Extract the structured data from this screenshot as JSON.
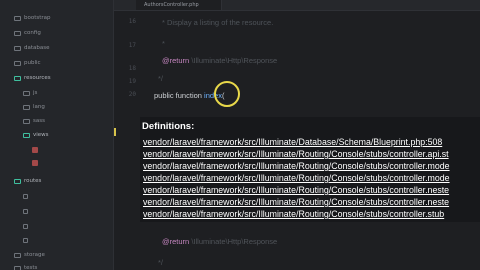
{
  "sidebar": {
    "items": [
      {
        "label": "bootstrap"
      },
      {
        "label": "config"
      },
      {
        "label": "database"
      },
      {
        "label": "public"
      },
      {
        "label": "resources"
      },
      {
        "label": "js"
      },
      {
        "label": "lang"
      },
      {
        "label": "sass"
      },
      {
        "label": "views"
      },
      {
        "label": "routes"
      },
      {
        "label": "storage"
      },
      {
        "label": "tests"
      }
    ]
  },
  "tabs": [
    {
      "label": "AuthorsController.php"
    }
  ],
  "editor": {
    "line_numbers": [
      "16",
      "17",
      "18",
      "19",
      "20"
    ],
    "lines": {
      "comment_desc": "* Display a listing of the resource.",
      "comment_star": "*",
      "return_tag": "@return",
      "return_type": "\\Illuminate\\Http\\Response",
      "comment_end": "*/",
      "method_keywords": "public function",
      "method_name": "index",
      "method_paren": "(",
      "return_tag_2": "@return",
      "return_type_2": "\\Illuminate\\Http\\Response",
      "comment_end_2": "*/"
    }
  },
  "popup": {
    "title": "Definitions:",
    "definitions": [
      "vendor/laravel/framework/src/Illuminate/Database/Schema/Blueprint.php:508",
      "vendor/laravel/framework/src/Illuminate/Routing/Console/stubs/controller.api.st",
      "vendor/laravel/framework/src/Illuminate/Routing/Console/stubs/controller.mode",
      "vendor/laravel/framework/src/Illuminate/Routing/Console/stubs/controller.mode",
      "vendor/laravel/framework/src/Illuminate/Routing/Console/stubs/controller.neste",
      "vendor/laravel/framework/src/Illuminate/Routing/Console/stubs/controller.neste",
      "vendor/laravel/framework/src/Illuminate/Routing/Console/stubs/controller.stub"
    ]
  },
  "colors": {
    "background": "#1e1f22",
    "sidebar": "#24262a",
    "popup": "#17181b",
    "accent_teal": "#3fbf9e",
    "cursor_highlight": "#e8d84a",
    "function_name": "#6db3ff",
    "annotation": "#c586c0"
  }
}
